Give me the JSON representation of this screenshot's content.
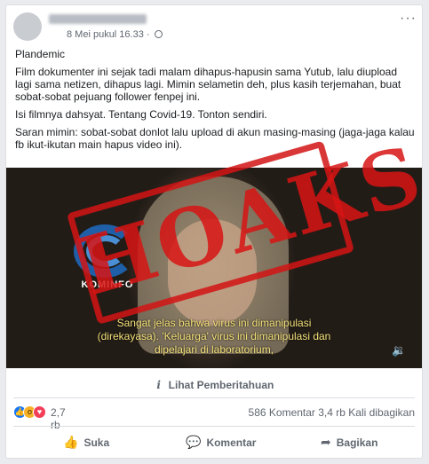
{
  "post": {
    "timestamp": "8 Mei pukul 16.33 ·",
    "more_icon": "···",
    "paragraphs": [
      "Plandemic",
      "Film dokumenter ini sejak tadi malam dihapus-hapusin sama Yutub, lalu diupload lagi sama netizen, dihapus lagi. Mimin selametin deh, plus kasih terjemahan, buat sobat-sobat pejuang follower fenpej ini.",
      "Isi filmnya dahsyat. Tentang Covid-19. Tonton sendiri.",
      "Saran mimin: sobat-sobat donlot lalu upload di akun masing-masing (jaga-jaga kalau fb ikut-ikutan main hapus video ini)."
    ]
  },
  "video": {
    "logo_text": "KOMINFO",
    "stamp_text": "HOAKS",
    "subtitle_lines": [
      "Sangat jelas bahwa virus ini dimanipulasi",
      "(direkayasa). 'Keluarga' virus ini dimanipulasi dan",
      "dipelajari di laboratorium,"
    ],
    "volume_icon": "🔉"
  },
  "notice": {
    "icon": "i",
    "label": "Lihat Pemberitahuan"
  },
  "stats": {
    "reaction_count": "2,7 rb",
    "comments_shares": "586 Komentar  3,4 rb Kali dibagikan",
    "reaction_icons": [
      "like-icon",
      "wow-icon",
      "love-icon"
    ]
  },
  "actions": {
    "like": "Suka",
    "comment": "Komentar",
    "share": "Bagikan"
  },
  "colors": {
    "stamp": "#d71414",
    "subtitle": "#f5e27a",
    "like": "#1877f2",
    "love": "#f33e58",
    "wow": "#f7b125"
  }
}
